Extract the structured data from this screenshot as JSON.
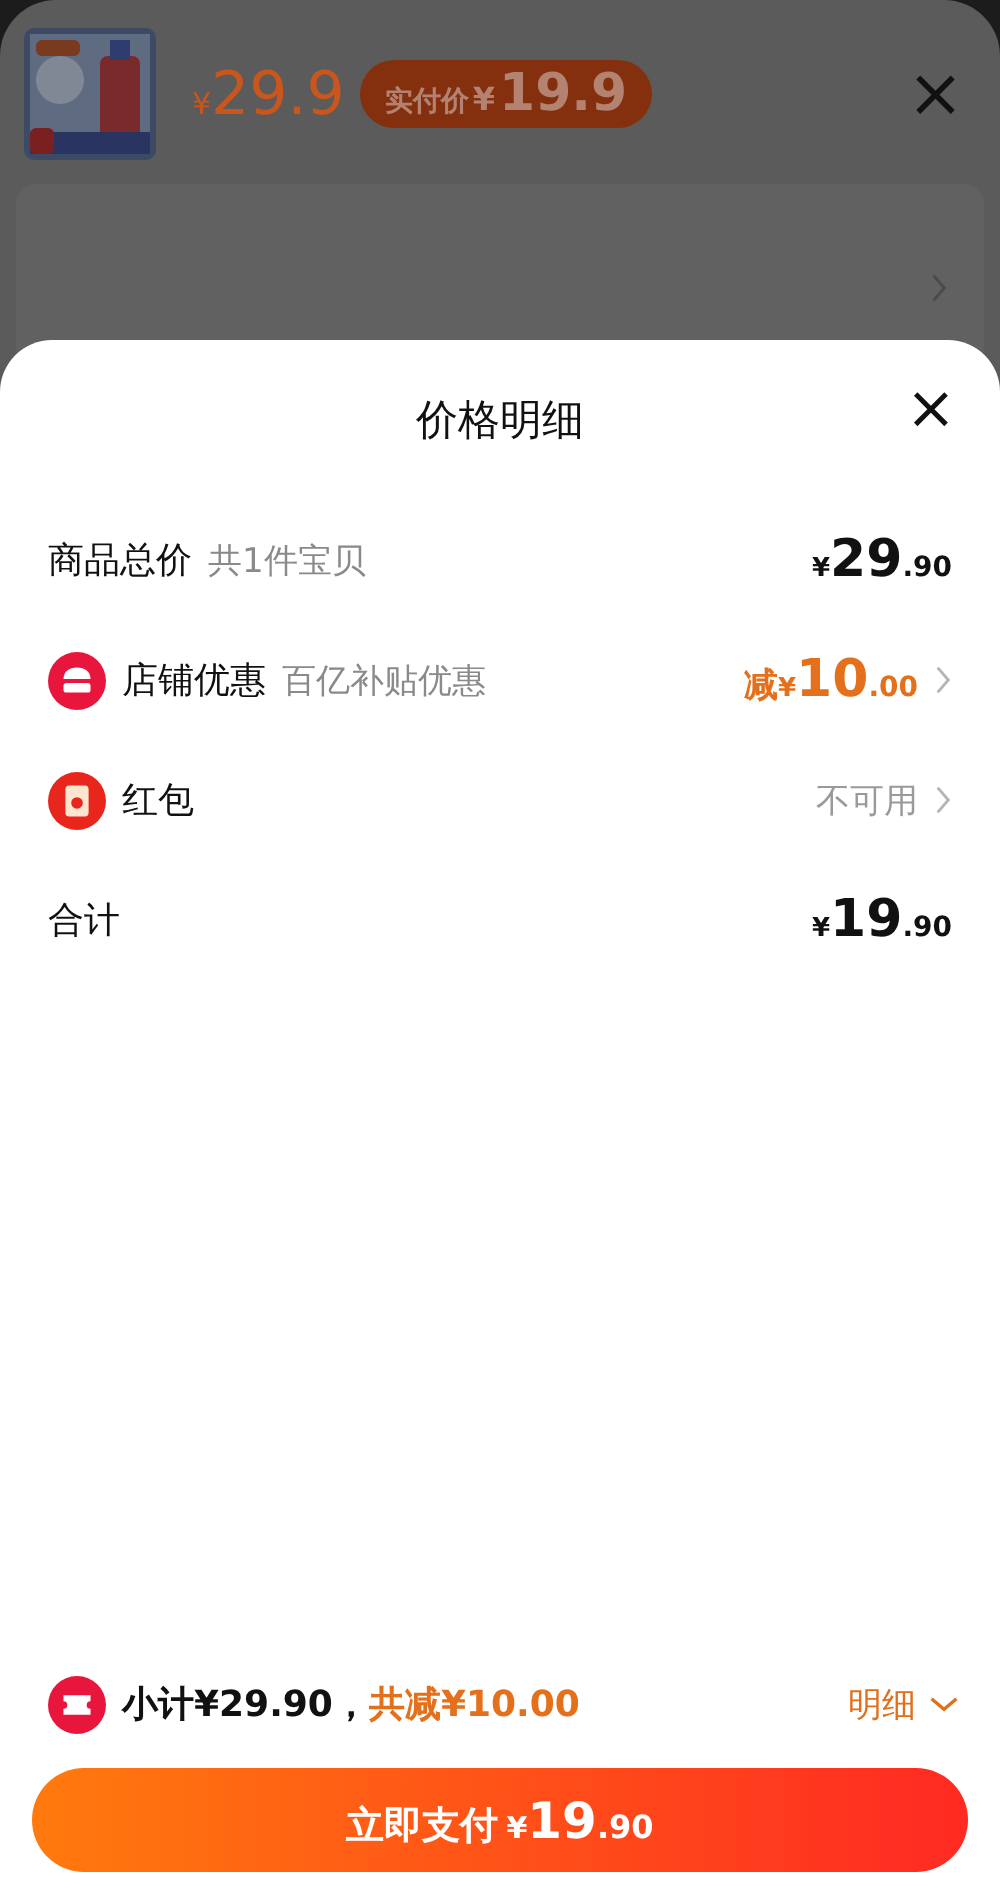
{
  "product": {
    "price": {
      "symbol": "¥",
      "amount": "29.9"
    },
    "badge": {
      "label": "实付价",
      "symbol": "¥",
      "amount": "19.9"
    },
    "close": "×"
  },
  "sheet": {
    "title": "价格明细",
    "close": "×",
    "rows": [
      {
        "kind": "total",
        "label": "商品总价",
        "note": "共1件宝贝",
        "value": {
          "symbol": "¥",
          "integer": "29",
          "decimal": ".90"
        }
      },
      {
        "kind": "shop",
        "label": "店铺优惠",
        "note": "百亿补贴优惠",
        "value": {
          "prefix": "减",
          "symbol": "¥",
          "integer": "10",
          "decimal": ".00"
        }
      },
      {
        "kind": "redpacket",
        "label": "红包",
        "status": "不可用"
      },
      {
        "kind": "sum",
        "label": "合计",
        "value": {
          "symbol": "¥",
          "integer": "19",
          "decimal": ".90"
        }
      }
    ]
  },
  "footer": {
    "subtotal": "小计¥29.90，",
    "saved": "共减¥10.00",
    "details": "明细",
    "pay": {
      "label": "立即支付",
      "symbol": "¥",
      "integer": "19",
      "decimal": ".90"
    }
  }
}
